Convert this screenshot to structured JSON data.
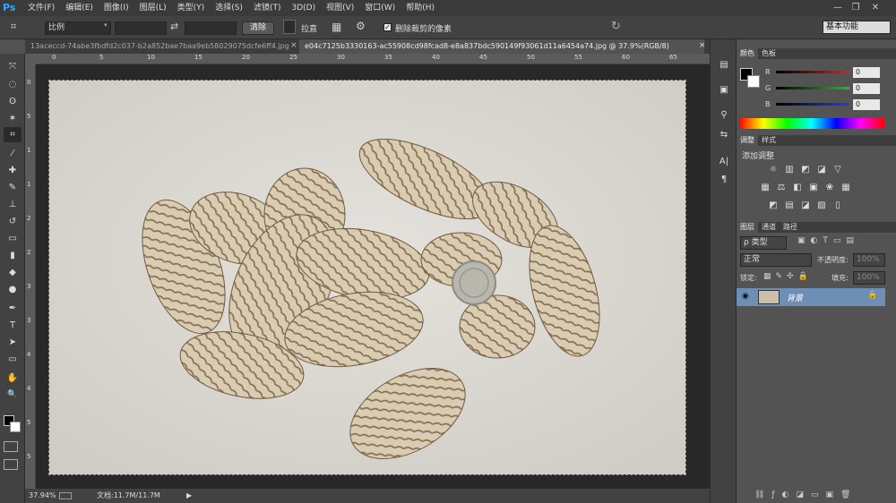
{
  "app": {
    "logo": "Ps",
    "menus": [
      "文件(F)",
      "编辑(E)",
      "图像(I)",
      "图层(L)",
      "类型(Y)",
      "选择(S)",
      "滤镜(T)",
      "3D(D)",
      "视图(V)",
      "窗口(W)",
      "帮助(H)"
    ],
    "window_controls": {
      "minimize": "—",
      "restore": "❐",
      "close": "✕"
    }
  },
  "options": {
    "ratio_label": "比例",
    "clear_button": "清除",
    "straighten_label": "拉直",
    "delete_cropped_label": "删除裁剪的像素",
    "delete_cropped_checked": true,
    "workspace": "基本功能"
  },
  "tabs": [
    {
      "label": "13aceccd-74abe3fbdfd2c037-b2a852bae7baa9eb58029075dcfe6ff4.jpg",
      "close": "×",
      "active": false
    },
    {
      "label": "e04c7125b3330163-ac55908cd98fcad8-e8a837bdc590149f93061d11a6454a74.jpg @ 37.9%(RGB/8)",
      "close": "×",
      "active": true
    }
  ],
  "ruler_ticks": [
    "0",
    "5",
    "10",
    "15",
    "20",
    "25",
    "30",
    "35",
    "40",
    "45",
    "50",
    "55",
    "60",
    "65"
  ],
  "ruler_v_ticks": [
    "0",
    "5",
    "1",
    "1",
    "2",
    "2",
    "3",
    "3",
    "4",
    "4",
    "5",
    "5"
  ],
  "status": {
    "zoom": "37.94%",
    "doc": "文档:11.7M/11.7M",
    "arrow": "▶"
  },
  "panels": {
    "color": {
      "tabs": [
        "颜色",
        "色板"
      ],
      "r_label": "R",
      "g_label": "G",
      "b_label": "B",
      "r": "0",
      "g": "0",
      "b": "0",
      "colors": {
        "r": "#e02020",
        "g": "#20c020",
        "b": "#2040e0"
      }
    },
    "adjustments": {
      "tabs": [
        "调整",
        "样式"
      ],
      "title": "添加调整"
    },
    "layers": {
      "tabs": [
        "图层",
        "通道",
        "路径"
      ],
      "filter_label": "ρ 类型",
      "blend_mode": "正常",
      "opacity_label": "不透明度:",
      "opacity_value": "100%",
      "lock_label": "锁定:",
      "fill_label": "填充:",
      "fill_value": "100%",
      "layer_name": "背景"
    }
  },
  "icons": {
    "move": "⤧",
    "marquee": "◌",
    "lasso": "ʘ",
    "wand": "✶",
    "crop": "⌗",
    "eyedropper": "⁄",
    "heal": "✚",
    "brush": "✎",
    "stamp": "⊥",
    "history": "↺",
    "eraser": "▭",
    "gradient": "▮",
    "blur": "◆",
    "dodge": "●",
    "pen": "✒",
    "type": "T",
    "path_select": "➤",
    "shape": "▭",
    "hand": "✋",
    "zoom": "🔍",
    "swap": "⇄",
    "rotate": "↻",
    "grid": "▦",
    "gear": "⚙",
    "settings": "≡",
    "dock": [
      "▤",
      "▣",
      "⚲",
      "⇆",
      "A|",
      "¶"
    ]
  }
}
